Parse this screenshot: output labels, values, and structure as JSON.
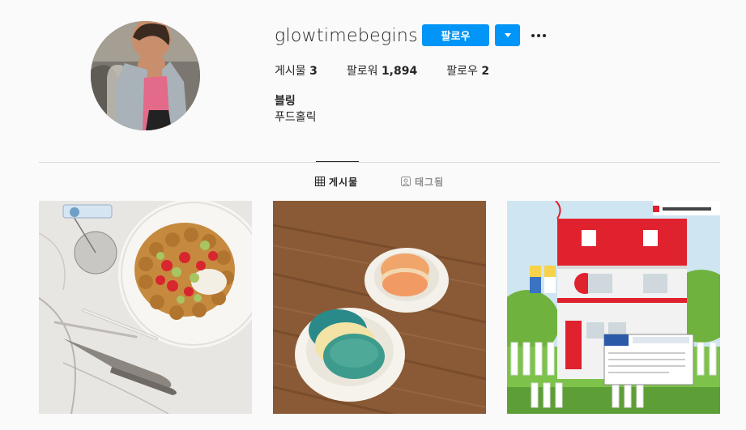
{
  "profile": {
    "username": "glowtimebegins",
    "follow_label": "팔로우",
    "stats": {
      "posts_label": "게시물",
      "posts_count": "3",
      "followers_label": "팔로워",
      "followers_count": "1,894",
      "following_label": "팔로우",
      "following_count": "2"
    },
    "bio": {
      "name": "블링",
      "text": "푸드홀릭"
    }
  },
  "tabs": [
    {
      "label": "게시물",
      "icon": "grid-icon",
      "active": true
    },
    {
      "label": "태그됨",
      "icon": "tag-person-icon",
      "active": false
    }
  ],
  "colors": {
    "accent": "#0095f6",
    "text": "#262626",
    "muted": "#8e8e8e",
    "background": "#fafafa"
  }
}
